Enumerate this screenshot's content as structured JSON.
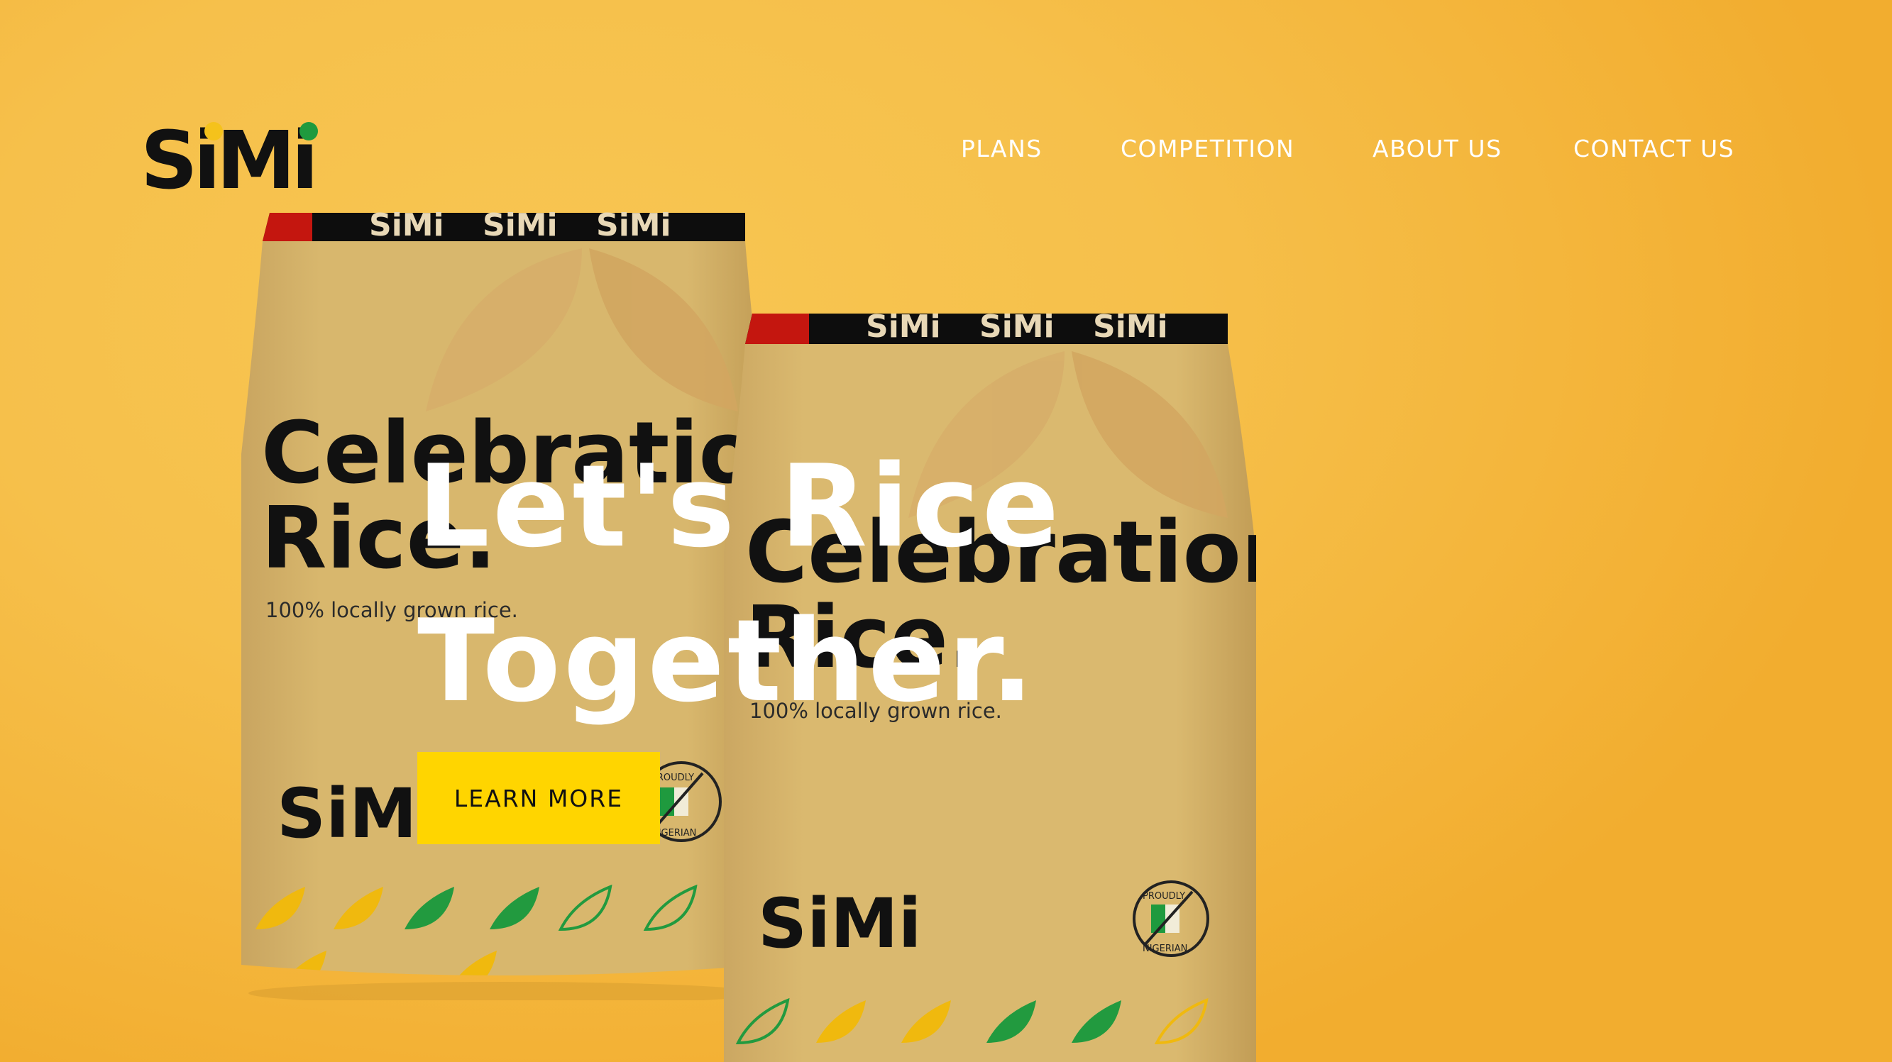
{
  "brand": {
    "logo_text": "SiMi",
    "colors": {
      "black": "#111111",
      "yellow": "#f5c21b",
      "green": "#1f9a3e"
    }
  },
  "nav": {
    "items": [
      {
        "label": "PLANS"
      },
      {
        "label": "COMPETITION"
      },
      {
        "label": "ABOUT US"
      },
      {
        "label": "CONTACT US"
      }
    ]
  },
  "hero": {
    "headline_line1": "Let's Rice",
    "headline_line2": "Together.",
    "cta_label": "LEARN MORE",
    "background_color": "#f6c04b",
    "cta_color": "#ffd500"
  },
  "products": [
    {
      "brand": "SiMi",
      "name_line1": "Celebration",
      "name_line2": "Rice.",
      "tagline": "100% locally grown rice.",
      "badge_top": "PROUDLY",
      "badge_bottom": "NIGERIAN"
    },
    {
      "brand": "SiMi",
      "name_line1": "Celebration",
      "name_line2": "Rice.",
      "tagline": "100% locally grown rice.",
      "badge_top": "PROUDLY",
      "badge_bottom": "NIGERIAN"
    }
  ]
}
